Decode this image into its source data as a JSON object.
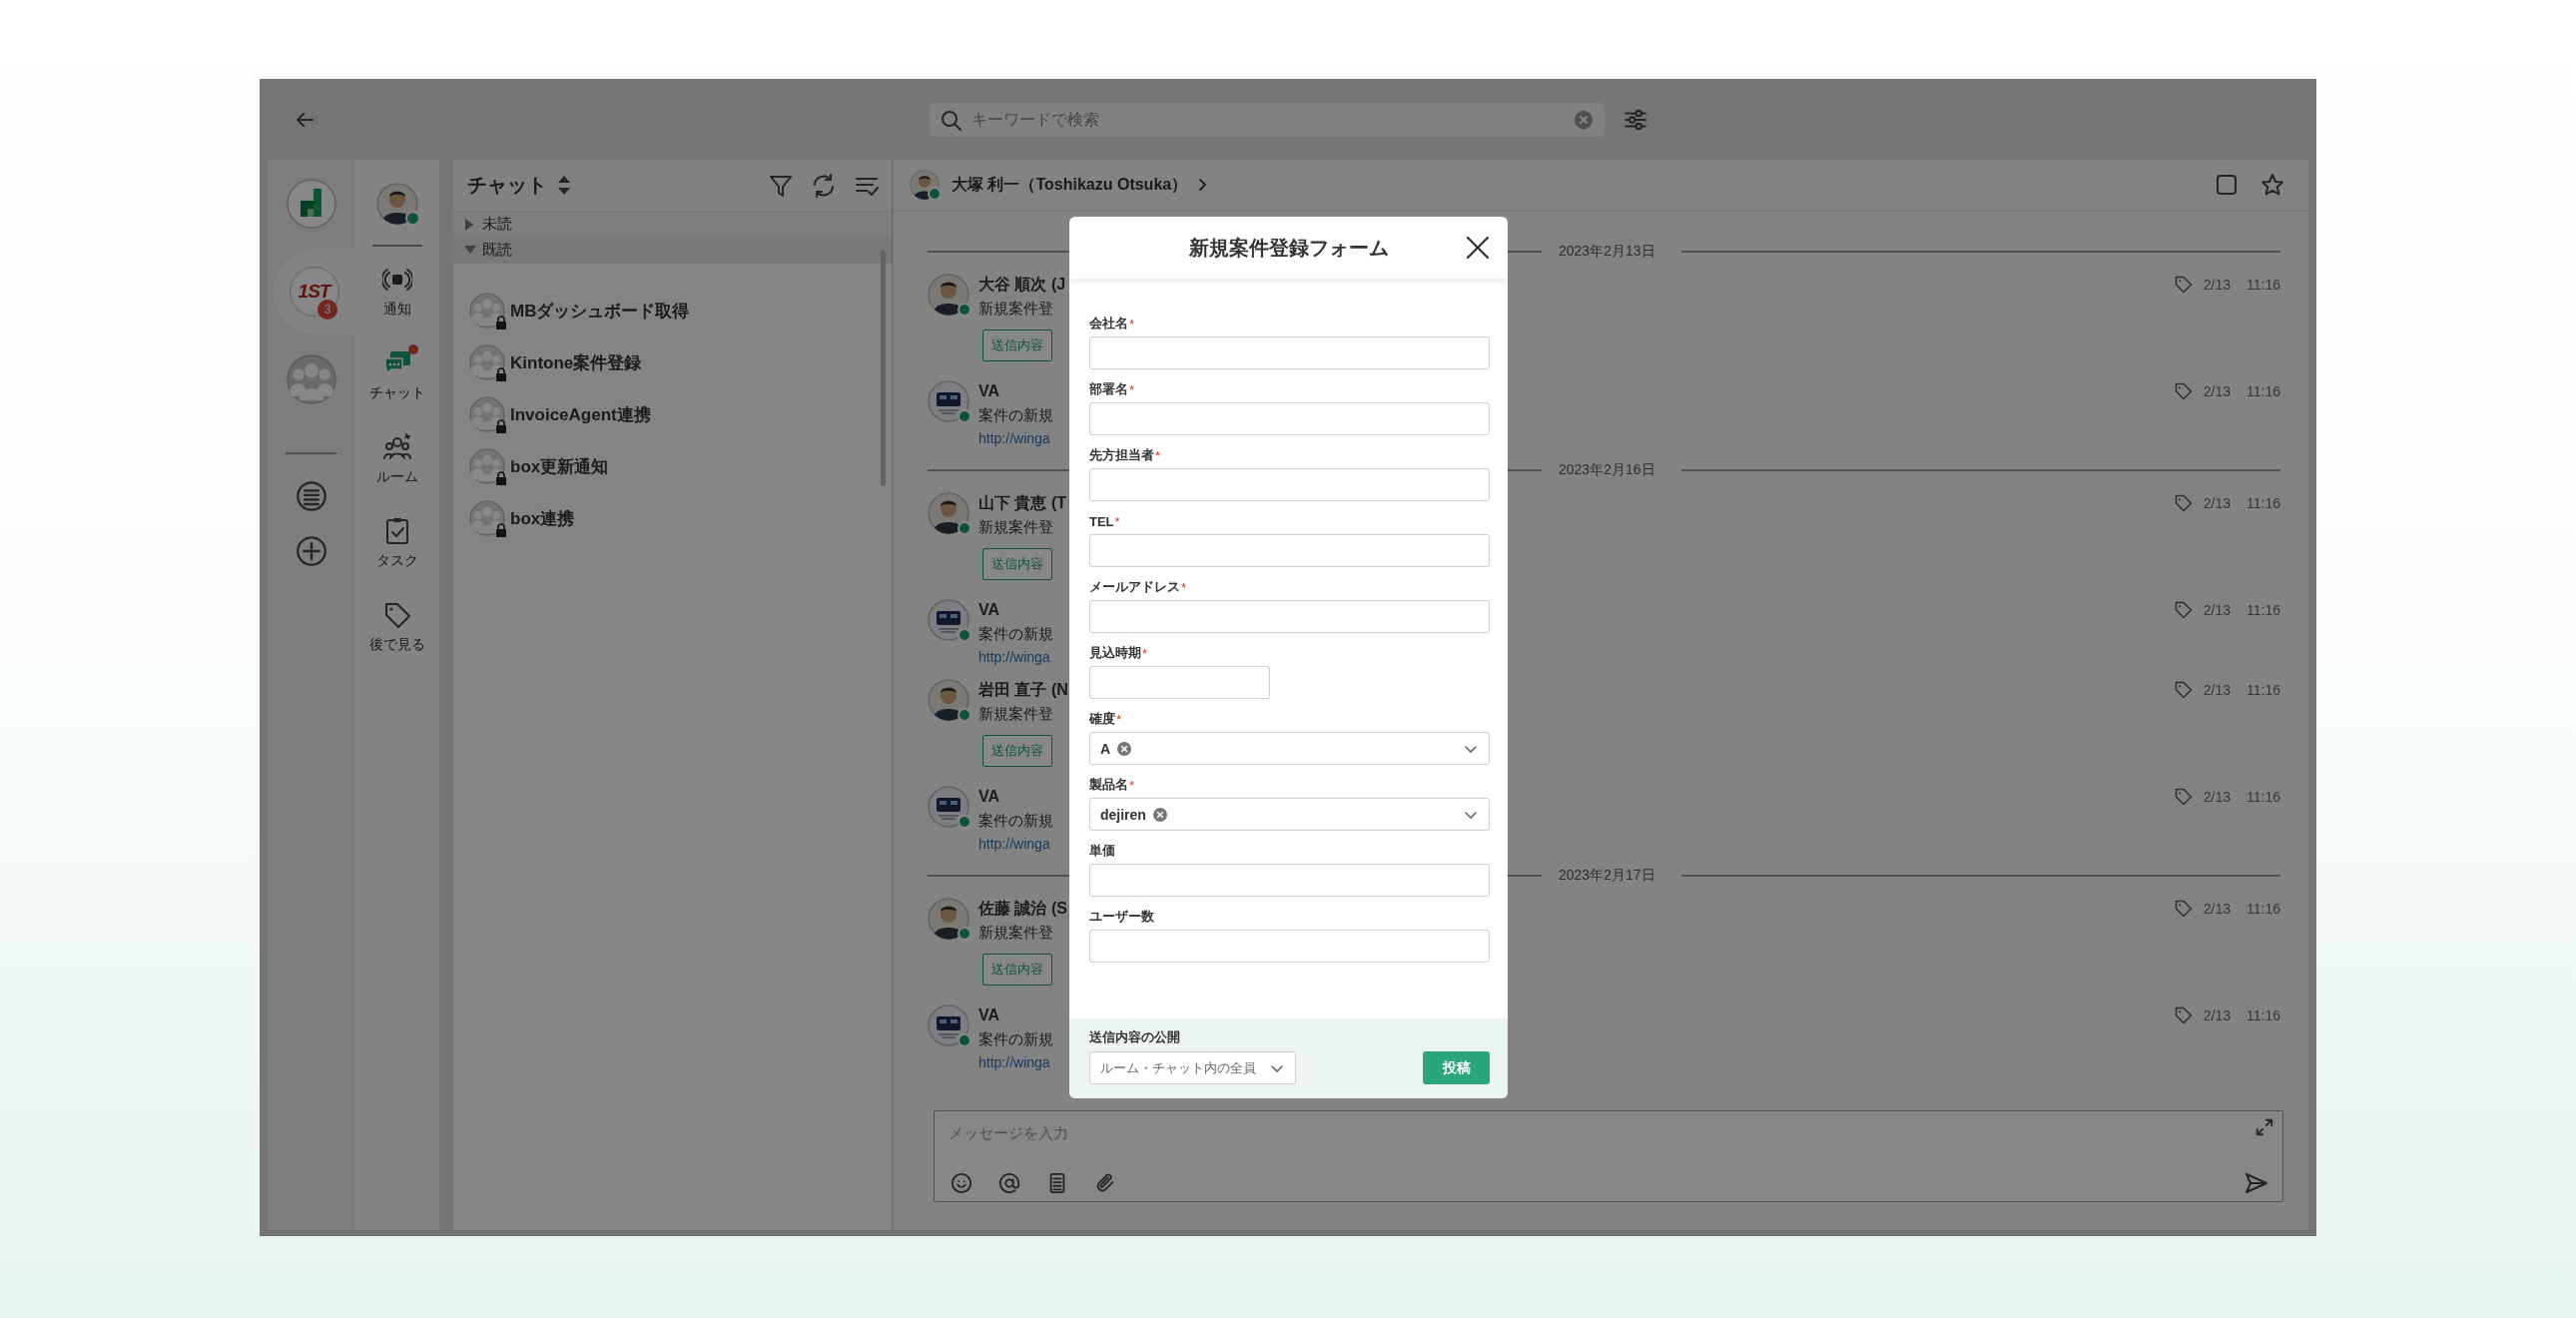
{
  "topbar": {
    "search": {
      "placeholder": "キーワードで検索"
    }
  },
  "workspaces": [
    {
      "kind": "app",
      "selected": false
    },
    {
      "kind": "team",
      "selected": true,
      "logo_text": "1ST",
      "badge": "3"
    },
    {
      "kind": "group",
      "selected": false
    }
  ],
  "user": {
    "online": true
  },
  "nav": [
    {
      "kind": "notifications",
      "label": "通知",
      "selected": false,
      "unread": false
    },
    {
      "kind": "chat",
      "label": "チャット",
      "selected": true,
      "unread": true
    },
    {
      "kind": "rooms",
      "label": "ルーム",
      "selected": false,
      "unread": false
    },
    {
      "kind": "tasks",
      "label": "タスク",
      "selected": false,
      "unread": false
    },
    {
      "kind": "later",
      "label": "後で見る",
      "selected": false,
      "unread": false
    }
  ],
  "chat_list": {
    "title": "チャット",
    "sections": [
      {
        "label": "未読",
        "expanded": false
      },
      {
        "label": "既読",
        "expanded": true,
        "items": [
          {
            "name": "MBダッシュボード取得",
            "locked": true
          },
          {
            "name": "Kintone案件登録",
            "locked": true
          },
          {
            "name": "InvoiceAgent連携",
            "locked": true
          },
          {
            "name": "box更新通知",
            "locked": true
          },
          {
            "name": "box連携",
            "locked": true
          }
        ]
      }
    ]
  },
  "conversation": {
    "title": "大塚 利一（Toshikazu Otsuka）",
    "online": true,
    "days": [
      {
        "date": "2023年2月13日",
        "messages": [
          {
            "kind": "user",
            "author": "大谷 順次 (J",
            "text": "新規案件登",
            "button": "送信内容",
            "date": "2/13",
            "time": "11:16",
            "online": true
          },
          {
            "kind": "bot",
            "author": "VA",
            "text": "案件の新規",
            "link": "http://winga",
            "date": "2/13",
            "time": "11:16",
            "online": true
          }
        ]
      },
      {
        "date": "2023年2月16日",
        "messages": [
          {
            "kind": "user",
            "author": "山下 貴恵 (T",
            "text": "新規案件登",
            "button": "送信内容",
            "date": "2/13",
            "time": "11:16",
            "online": true
          },
          {
            "kind": "bot",
            "author": "VA",
            "text": "案件の新規",
            "link": "http://winga",
            "date": "2/13",
            "time": "11:16",
            "online": true
          },
          {
            "kind": "user",
            "author": "岩田 直子 (N",
            "text": "新規案件登",
            "button": "送信内容",
            "date": "2/13",
            "time": "11:16",
            "online": true
          },
          {
            "kind": "bot",
            "author": "VA",
            "text": "案件の新規",
            "link": "http://winga",
            "date": "2/13",
            "time": "11:16",
            "online": true
          }
        ]
      },
      {
        "date": "2023年2月17日",
        "messages": [
          {
            "kind": "user",
            "author": "佐藤 誠治 (S",
            "text": "新規案件登",
            "button": "送信内容",
            "date": "2/13",
            "time": "11:16",
            "online": true
          },
          {
            "kind": "bot",
            "author": "VA",
            "text": "案件の新規",
            "link": "http://winga",
            "date": "2/13",
            "time": "11:16",
            "online": true
          }
        ]
      }
    ],
    "composer": {
      "placeholder": "メッセージを入力"
    }
  },
  "modal": {
    "title": "新規案件登録フォーム",
    "fields": [
      {
        "kind": "text",
        "label": "会社名",
        "mark": "*"
      },
      {
        "kind": "text",
        "label": "部署名",
        "mark": "*"
      },
      {
        "kind": "text",
        "label": "先方担当者",
        "mark": "*"
      },
      {
        "kind": "text",
        "label": "TEL",
        "mark": "*"
      },
      {
        "kind": "text",
        "label": "メールアドレス",
        "mark": "*"
      },
      {
        "kind": "date",
        "label": "見込時期",
        "mark": "*"
      },
      {
        "kind": "select",
        "label": "確度",
        "mark": "*",
        "chips": [
          "A"
        ]
      },
      {
        "kind": "select",
        "label": "製品名",
        "mark": "*",
        "chips": [
          "dejiren"
        ]
      },
      {
        "kind": "text",
        "label": "単価"
      },
      {
        "kind": "text",
        "label": "ユーザー数"
      }
    ],
    "footer": {
      "label": "送信内容の公開",
      "visibility": "ルーム・チャット内の全員",
      "submit": "投稿"
    }
  }
}
